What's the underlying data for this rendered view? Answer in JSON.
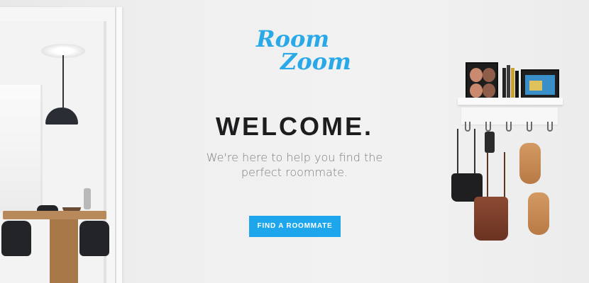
{
  "logo": {
    "line1": "Room",
    "line2": "Zoom",
    "color": "#29a9e8"
  },
  "hero": {
    "heading": "WELCOME.",
    "tagline_line1": "We're here to help you find the",
    "tagline_line2": "perfect roommate.",
    "cta_label": "FIND A ROOMMATE",
    "cta_color": "#1ea6ec"
  },
  "scene": {
    "background_color": "#efefef",
    "left_photo": "doorway-dining-room-image",
    "right_photo": "shelf-with-hooks-image"
  }
}
